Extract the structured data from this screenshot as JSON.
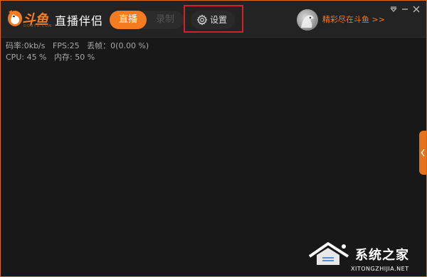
{
  "app": {
    "logo_text": "斗鱼",
    "logo_subtext": "DOUYU.COM",
    "title": "直播伴侣"
  },
  "modes": {
    "live_label": "直播",
    "record_label": "录制",
    "active": "live"
  },
  "settings": {
    "label": "设置",
    "icon": "gear-icon"
  },
  "user": {
    "link_label": "精彩尽在斗鱼 >>",
    "avatar": "avatar"
  },
  "window_controls": [
    "dropdown-icon",
    "minimize-icon",
    "close-icon"
  ],
  "stats": {
    "row1": {
      "bitrate": "码率:0kb/s",
      "fps": "FPS:25",
      "dropped": "丢帧：0(0.00 %)"
    },
    "row2": {
      "cpu": "CPU: 45 %",
      "memory": "内存: 50 %"
    }
  },
  "watermark": {
    "text": "系统之家",
    "url": "XITONGZHIJIA.NET"
  },
  "colors": {
    "accent": "#f47b20",
    "highlight": "#d81e2a",
    "background": "#181818"
  }
}
